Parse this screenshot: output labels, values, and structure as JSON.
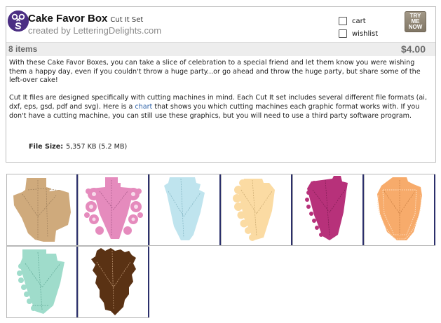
{
  "product": {
    "title": "Cake Favor Box",
    "subtitle": "Cut It Set",
    "byline": "created by LetteringDelights.com",
    "item_count": "8 items",
    "price": "$4.00"
  },
  "actions": {
    "cart_label": "cart",
    "wishlist_label": "wishlist",
    "try_me": [
      "TRY",
      "ME",
      "NOW"
    ]
  },
  "description": {
    "paragraph1": "With these Cake Favor Boxes, you can take a slice of celebration to a special friend and let them know you were wishing them a happy day, even if you couldn't throw a huge party...or go ahead and throw the huge party, but share some of the left-over cake!",
    "paragraph2_before_link": "Cut It files are designed specifically with cutting machines in mind. Each Cut It set includes several different file formats (ai, dxf, eps, gsd, pdf and svg). Here is a ",
    "paragraph2_link": "chart",
    "paragraph2_after_link": " that shows you which cutting machines each graphic format works with. If you don't have a cutting machine, you can still use these graphics, but you will need to use a third party software program."
  },
  "file_size": {
    "label": "File Size:",
    "value": "5,357 KB (5.2 MB)"
  },
  "thumbnails": [
    {
      "name": "plain-box",
      "color": "#cfaa7c"
    },
    {
      "name": "flourish",
      "color": "#e58bbd"
    },
    {
      "name": "light-blue",
      "color": "#bfe4ee"
    },
    {
      "name": "scalloped-cream",
      "color": "#fbdba3"
    },
    {
      "name": "dotted-magenta",
      "color": "#b7317a"
    },
    {
      "name": "lace-orange",
      "color": "#f7ab6b"
    },
    {
      "name": "mint",
      "color": "#9fdccb"
    },
    {
      "name": "brown-rough",
      "color": "#5a3214"
    }
  ],
  "colors": {
    "logo": "#4b2e83",
    "link": "#3366aa",
    "bar": "#ededed",
    "thumb_edge": "#2b2f6b"
  }
}
